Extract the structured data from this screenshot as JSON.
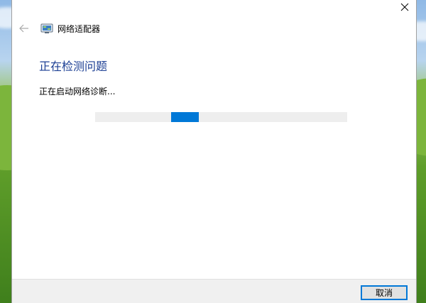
{
  "window": {
    "title": "网络适配器",
    "icon": "network-adapter-icon"
  },
  "nav": {
    "back_icon": "back-arrow-icon",
    "close_icon": "close-icon"
  },
  "main": {
    "heading": "正在检测问题",
    "status": "正在启动网络诊断...",
    "progress": {
      "mode": "indeterminate",
      "chunk_start_fraction": 0.3,
      "chunk_width_fraction": 0.11,
      "color": "#0078d7"
    }
  },
  "footer": {
    "cancel_label": "取消"
  },
  "colors": {
    "heading": "#1c3f94",
    "accent": "#0078d7",
    "footer_bg": "#f0f0f0"
  }
}
